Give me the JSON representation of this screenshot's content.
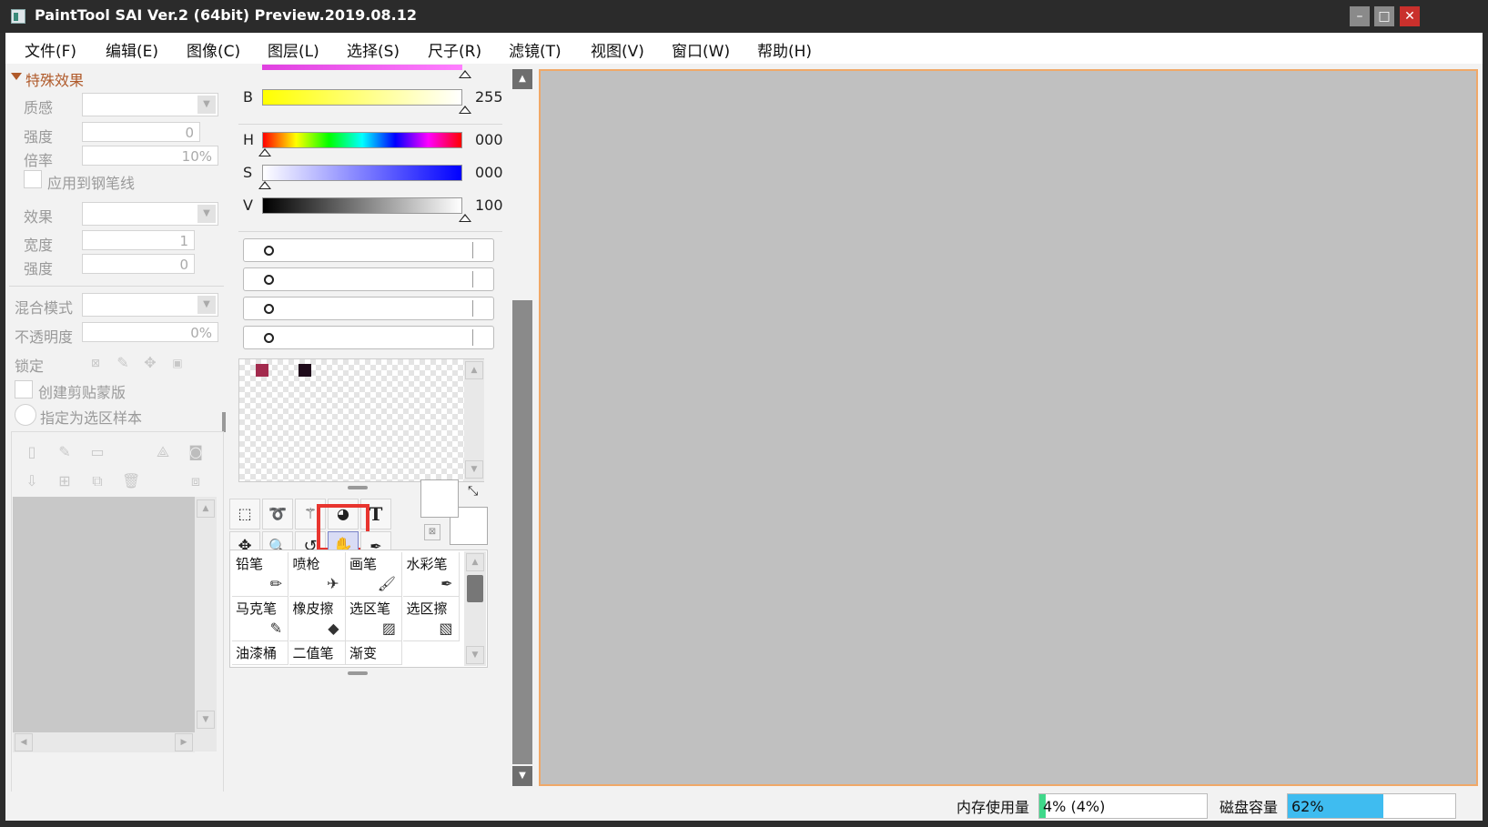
{
  "window": {
    "title": "PaintTool SAI Ver.2 (64bit) Preview.2019.08.12",
    "minimize": "–",
    "maximize": "□",
    "close": "✕"
  },
  "menu": [
    "文件(F)",
    "编辑(E)",
    "图像(C)",
    "图层(L)",
    "选择(S)",
    "尺子(R)",
    "滤镜(T)",
    "视图(V)",
    "窗口(W)",
    "帮助(H)"
  ],
  "layer_panel": {
    "section_title": "特殊效果",
    "texture_label": "质感",
    "strength_label": "强度",
    "strength_value": "0",
    "ratio_label": "倍率",
    "ratio_value": "10%",
    "apply_pen_label": "应用到钢笔线",
    "effect_label": "效果",
    "width_label": "宽度",
    "width_value": "1",
    "strength2_label": "强度",
    "strength2_value": "0",
    "blend_label": "混合模式",
    "opacity_label": "不透明度",
    "opacity_value": "0%",
    "lock_label": "锁定",
    "clip_label": "创建剪贴蒙版",
    "selection_source_label": "指定为选区样本"
  },
  "color_panel": {
    "b_label": "B",
    "b_value": "255",
    "h_label": "H",
    "h_value": "000",
    "s_label": "S",
    "s_value": "000",
    "v_label": "V",
    "v_value": "100",
    "swatches": [
      "#a32b4e",
      "#1e0a1a"
    ],
    "primary_color": "#ffffff",
    "secondary_color": "#ffffff"
  },
  "tools": {
    "text_tool_glyph": "T",
    "highlighted_tool": "hand"
  },
  "brushes": [
    {
      "name": "铅笔",
      "icon": "pencil-icon"
    },
    {
      "name": "喷枪",
      "icon": "airbrush-icon"
    },
    {
      "name": "画笔",
      "icon": "brush-icon"
    },
    {
      "name": "水彩笔",
      "icon": "watercolor-icon"
    },
    {
      "name": "马克笔",
      "icon": "marker-icon"
    },
    {
      "name": "橡皮擦",
      "icon": "eraser-icon"
    },
    {
      "name": "选区笔",
      "icon": "selection-pen-icon"
    },
    {
      "name": "选区擦",
      "icon": "selection-eraser-icon"
    },
    {
      "name": "油漆桶",
      "icon": ""
    },
    {
      "name": "二值笔",
      "icon": ""
    },
    {
      "name": "渐变",
      "icon": ""
    }
  ],
  "status": {
    "memory_label": "内存使用量",
    "memory_value": "4% (4%)",
    "memory_fraction": 0.04,
    "disk_label": "磁盘容量",
    "disk_value": "62%",
    "disk_fraction": 0.62
  },
  "colors": {
    "canvas": "#c0c0c0",
    "canvas_border": "#f0a868",
    "highlight": "#e8342e",
    "disk_bar": "#3fbcf0"
  }
}
